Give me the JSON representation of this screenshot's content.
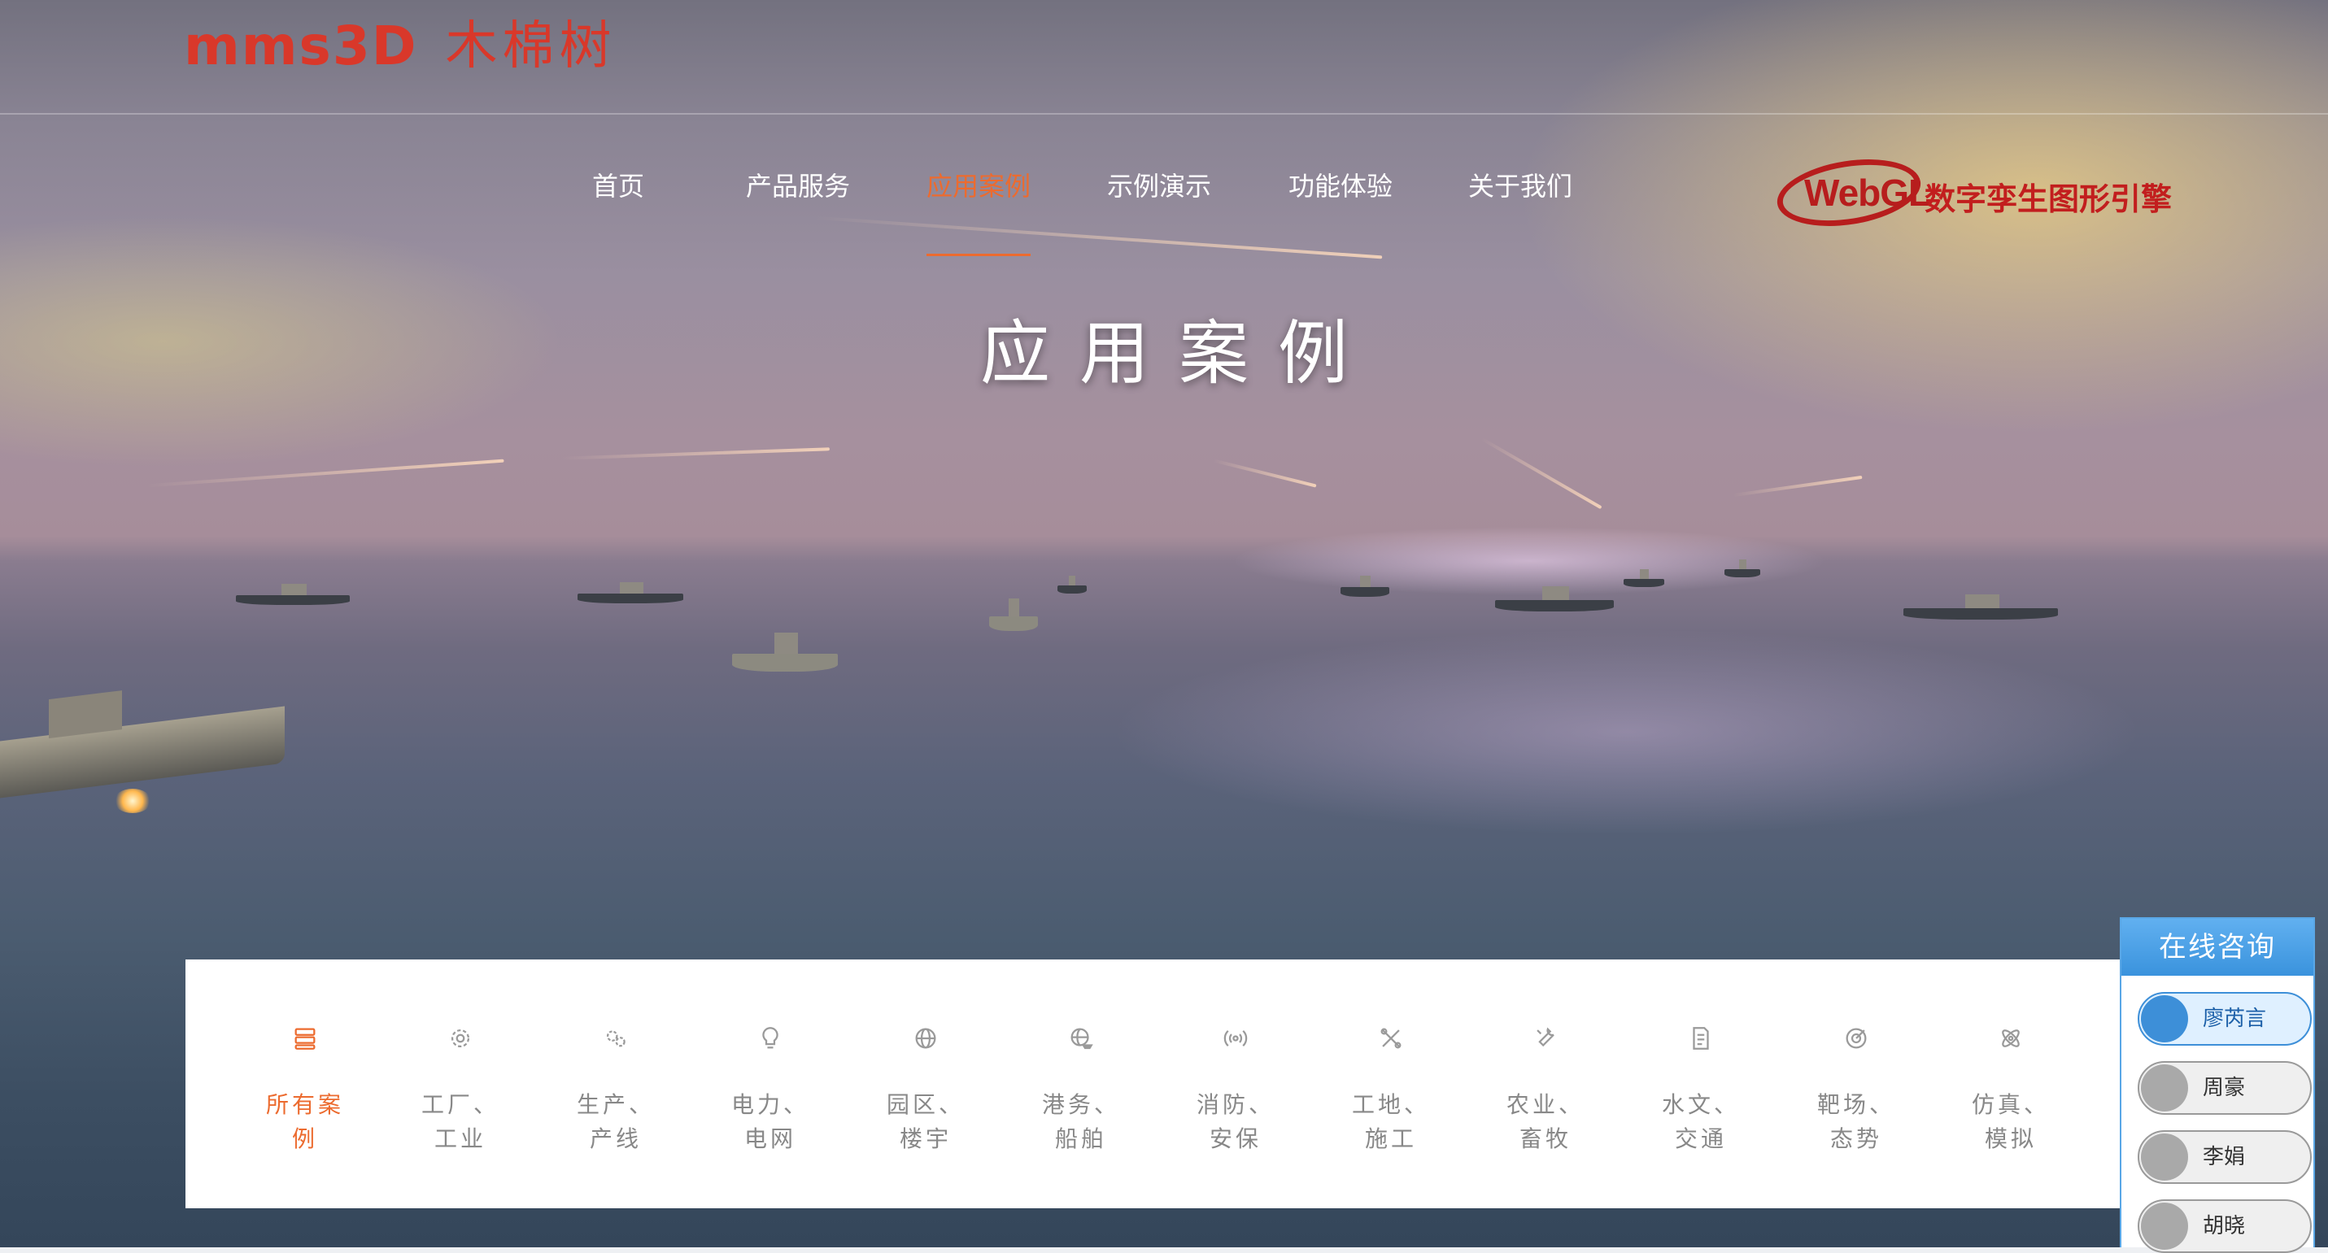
{
  "header": {
    "logo_mark": "mms3D",
    "logo_cn": "木棉树",
    "badge_webgl": "WebGL",
    "badge_text": "数字孪生图形引擎"
  },
  "nav": {
    "items": [
      {
        "label": "首页"
      },
      {
        "label": "产品服务"
      },
      {
        "label": "应用案例",
        "active": true
      },
      {
        "label": "示例演示"
      },
      {
        "label": "功能体验"
      },
      {
        "label": "关于我们"
      }
    ]
  },
  "hero": {
    "title": "应用案例"
  },
  "categories": [
    {
      "label": "所有案例",
      "icon": "list-icon",
      "active": true
    },
    {
      "label": "工厂、工业",
      "icon": "gear-icon"
    },
    {
      "label": "生产、产线",
      "icon": "gears-icon"
    },
    {
      "label": "电力、电网",
      "icon": "lightbulb-icon"
    },
    {
      "label": "园区、楼宇",
      "icon": "globe-icon"
    },
    {
      "label": "港务、船舶",
      "icon": "world-ship-icon"
    },
    {
      "label": "消防、安保",
      "icon": "signal-icon"
    },
    {
      "label": "工地、施工",
      "icon": "tools-icon"
    },
    {
      "label": "农业、畜牧",
      "icon": "wrench-icon"
    },
    {
      "label": "水文、交通",
      "icon": "document-icon"
    },
    {
      "label": "靶场、态势",
      "icon": "target-icon"
    },
    {
      "label": "仿真、模拟",
      "icon": "atom-icon"
    }
  ],
  "consult": {
    "title": "在线咨询",
    "agents": [
      {
        "name": "廖芮言",
        "active": true
      },
      {
        "name": "周豪"
      },
      {
        "name": "李娟"
      },
      {
        "name": "胡晓"
      }
    ]
  },
  "colors": {
    "accent": "#ec6b2f",
    "logo_red": "#d9382a",
    "consult_blue": "#3d8fd8"
  }
}
